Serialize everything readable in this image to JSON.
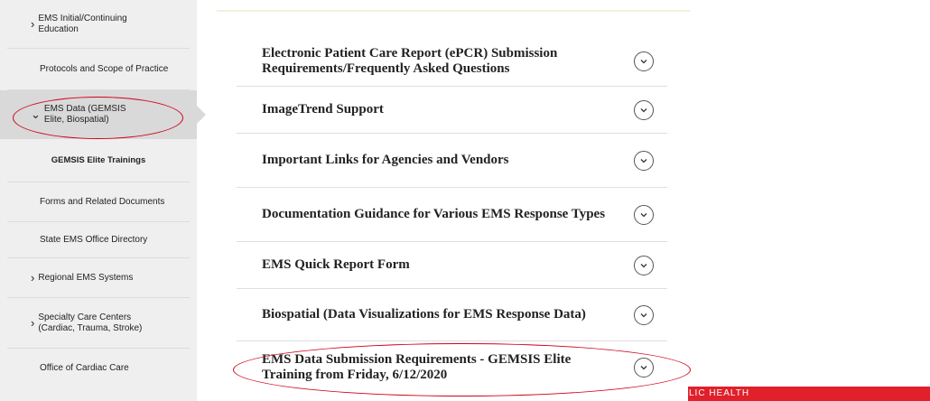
{
  "sidebar": {
    "items": [
      {
        "label": "EMS Initial/Continuing Education",
        "chevron": "›"
      },
      {
        "label": "Protocols and Scope of Practice"
      },
      {
        "label": "EMS Data (GEMSIS Elite, Biospatial)",
        "chevron": "⌄"
      },
      {
        "label": "GEMSIS Elite Trainings"
      },
      {
        "label": "Forms and Related Documents"
      },
      {
        "label": "State EMS Office Directory"
      },
      {
        "label": "Regional EMS Systems",
        "chevron": "›"
      },
      {
        "label": "Specialty Care Centers (Cardiac, Trauma, Stroke)",
        "chevron": "›"
      },
      {
        "label": "Office of Cardiac Care"
      }
    ]
  },
  "accordion": {
    "items": [
      {
        "title": "Electronic Patient Care Report (ePCR) Submission Requirements/Frequently Asked Questions"
      },
      {
        "title": "ImageTrend Support"
      },
      {
        "title": "Important Links for Agencies and Vendors"
      },
      {
        "title": "Documentation Guidance for Various EMS Response Types"
      },
      {
        "title": "EMS Quick Report Form"
      },
      {
        "title": "Biospatial (Data Visualizations for EMS Response Data)"
      },
      {
        "title": "EMS Data Submission Requirements - GEMSIS Elite Training from Friday, 6/12/2020"
      }
    ]
  },
  "banner": {
    "text": "LIC HEALTH"
  },
  "colors": {
    "accent_red": "#e0202a",
    "annotation_red": "#d0021b",
    "sidebar_bg": "#efefef",
    "sidebar_active": "#d9d9d9"
  }
}
